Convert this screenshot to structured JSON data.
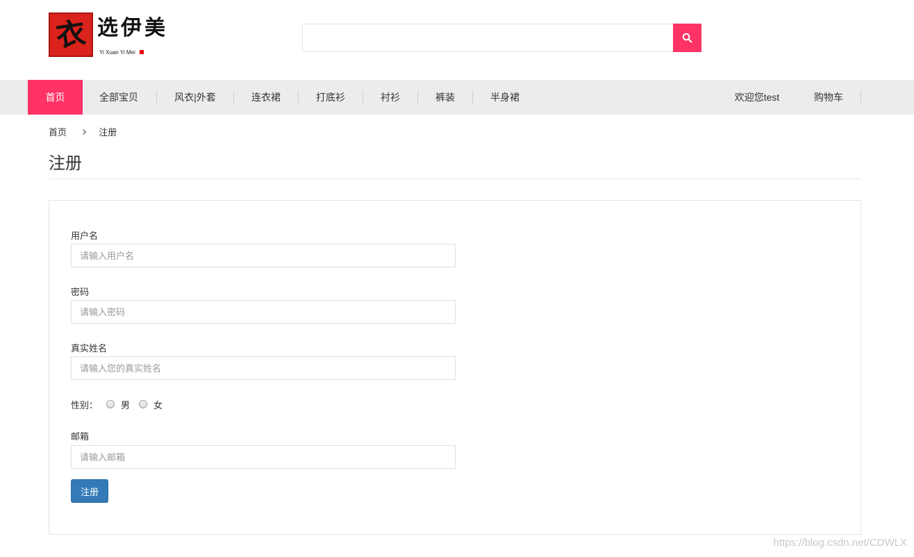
{
  "header": {
    "logo": {
      "badge_char": "衣",
      "text": "选伊美",
      "subtext": "Yi Xuan Yi Mei"
    },
    "search": {
      "value": "",
      "placeholder": "",
      "icon": "search-icon"
    },
    "accent_color": "#ff3366"
  },
  "nav": {
    "items": [
      {
        "label": "首页",
        "active": true
      },
      {
        "label": "全部宝贝"
      },
      {
        "label": "风衣|外套"
      },
      {
        "label": "连衣裙"
      },
      {
        "label": "打底衫"
      },
      {
        "label": "衬衫"
      },
      {
        "label": "裤装"
      },
      {
        "label": "半身裙"
      }
    ],
    "right": {
      "welcome": "欢迎您test",
      "cart": "购物车"
    }
  },
  "breadcrumb": {
    "home": "首页",
    "separator_icon": "chevron-right-icon",
    "current": "注册"
  },
  "page": {
    "title": "注册"
  },
  "form": {
    "username": {
      "label": "用户名",
      "placeholder": "请输入用户名",
      "value": ""
    },
    "password": {
      "label": "密码",
      "placeholder": "请输入密码",
      "value": ""
    },
    "realname": {
      "label": "真实姓名",
      "placeholder": "请输入您的真实姓名",
      "value": ""
    },
    "gender": {
      "label": "性别：",
      "options": [
        "男",
        "女"
      ],
      "selected": null
    },
    "email": {
      "label": "邮箱",
      "placeholder": "请输入邮箱",
      "value": ""
    },
    "submit_label": "注册",
    "submit_color": "#337ab7"
  },
  "watermark": "https://blog.csdn.net/CDWLX"
}
